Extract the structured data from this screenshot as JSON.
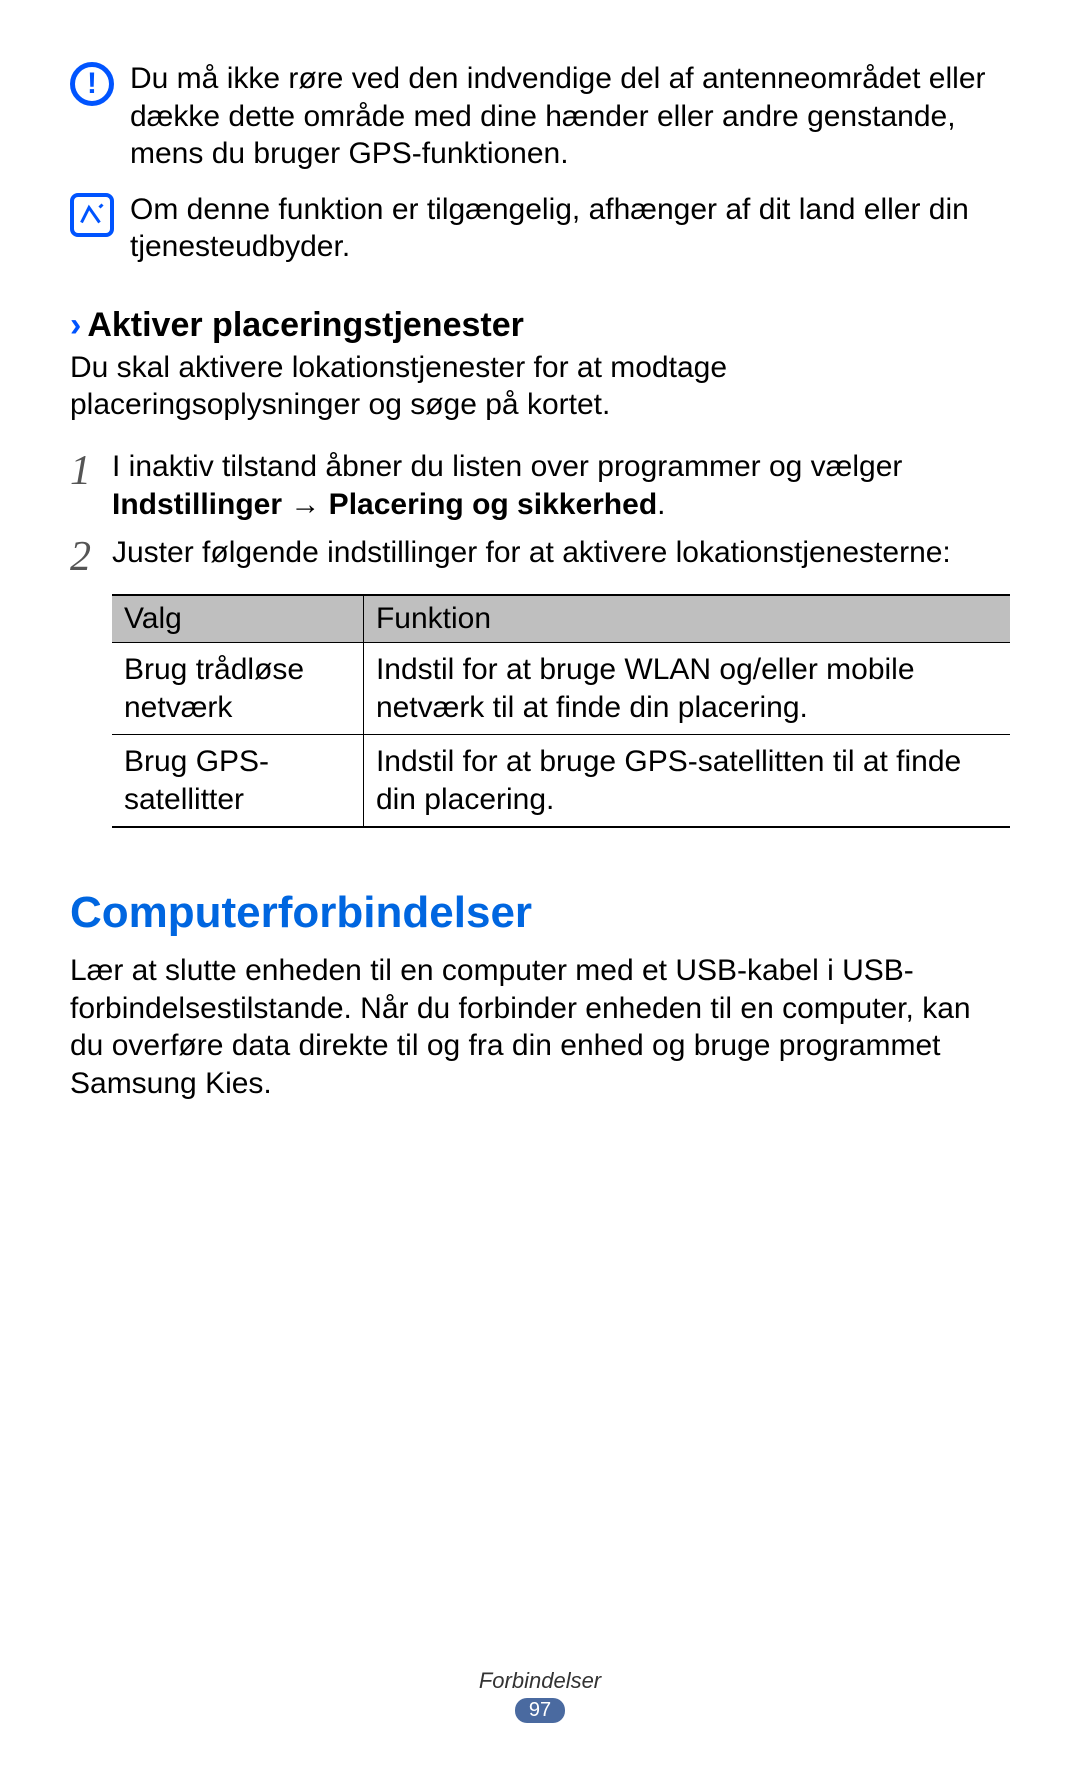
{
  "notes": {
    "warning": "Du må ikke røre ved den indvendige del af antenneområdet eller dække dette område med dine hænder eller andre genstande, mens du bruger GPS-funktionen.",
    "info": "Om denne funktion er tilgængelig, afhænger af dit land eller din tjenesteudbyder."
  },
  "section1": {
    "heading": "Aktiver placeringstjenester",
    "intro": "Du skal aktivere lokationstjenester for at modtage placeringsoplysninger og søge på kortet.",
    "step1_a": "I inaktiv tilstand åbner du listen over programmer og vælger ",
    "step1_b": "Indstillinger → Placering og sikkerhed",
    "step1_c": ".",
    "step2": "Juster følgende indstillinger for at aktivere lokationstjenesterne:",
    "table": {
      "head_opt": "Valg",
      "head_fn": "Funktion",
      "rows": [
        {
          "opt": "Brug trådløse netværk",
          "fn": "Indstil for at bruge WLAN og/eller mobile netværk til at finde din placering."
        },
        {
          "opt": "Brug GPS-satellitter",
          "fn": "Indstil for at bruge GPS-satellitten til at finde din placering."
        }
      ]
    }
  },
  "section2": {
    "heading": "Computerforbindelser",
    "body": "Lær at slutte enheden til en computer med et USB-kabel i USB-forbindelsestilstande. Når du forbinder enheden til en computer, kan du overføre data direkte til og fra din enhed og bruge programmet Samsung Kies."
  },
  "footer": {
    "label": "Forbindelser",
    "page": "97"
  }
}
